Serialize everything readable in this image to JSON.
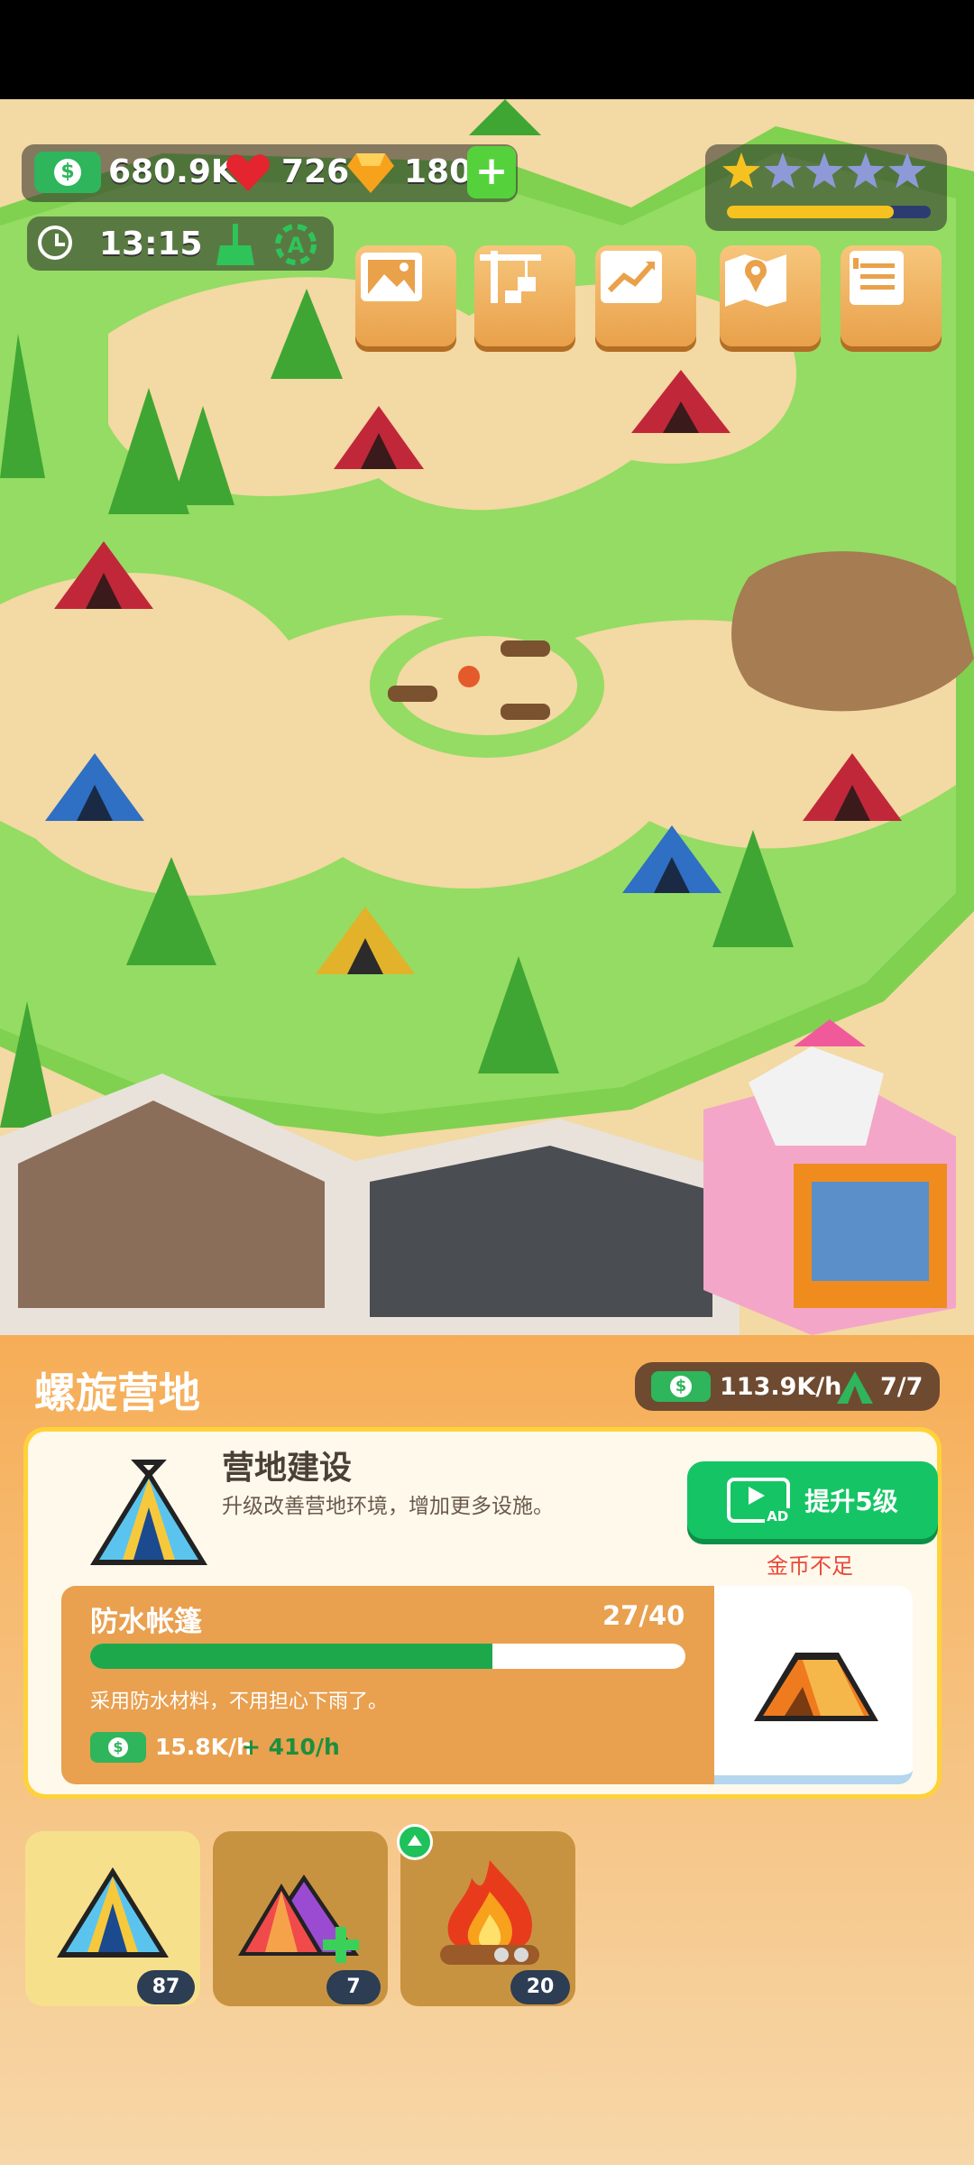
{
  "hud": {
    "money": "680.9K",
    "hearts": "726",
    "gems": "180",
    "timer": "13:15",
    "stars_filled": 1,
    "stars_total": 5,
    "star_progress": 0.82
  },
  "menu_icons": [
    "image-icon",
    "crane-icon",
    "chart-icon",
    "map-icon",
    "notes-icon"
  ],
  "panel": {
    "camp_name": "螺旋营地",
    "income_rate": "113.9K/h",
    "tents_count": "7/7",
    "section_title": "营地建设",
    "section_desc": "升级改善营地环境，增加更多设施。",
    "upgrade_button": "提升5级",
    "ad_label": "AD",
    "insufficient": "金币不足",
    "item_name": "防水帐篷",
    "item_progress_text": "27/40",
    "item_progress": 0.675,
    "item_desc": "采用防水材料，不用担心下雨了。",
    "item_income": "15.8K/h",
    "item_bonus": "+ 410/h"
  },
  "tabs": [
    {
      "count": "87",
      "icon": "tent-icon"
    },
    {
      "count": "7",
      "icon": "add-tents-icon"
    },
    {
      "count": "20",
      "icon": "campfire-icon"
    }
  ],
  "colors": {
    "accent_green": "#15c565",
    "panel_orange": "#f6ad56",
    "card_border": "#ffd23a"
  }
}
